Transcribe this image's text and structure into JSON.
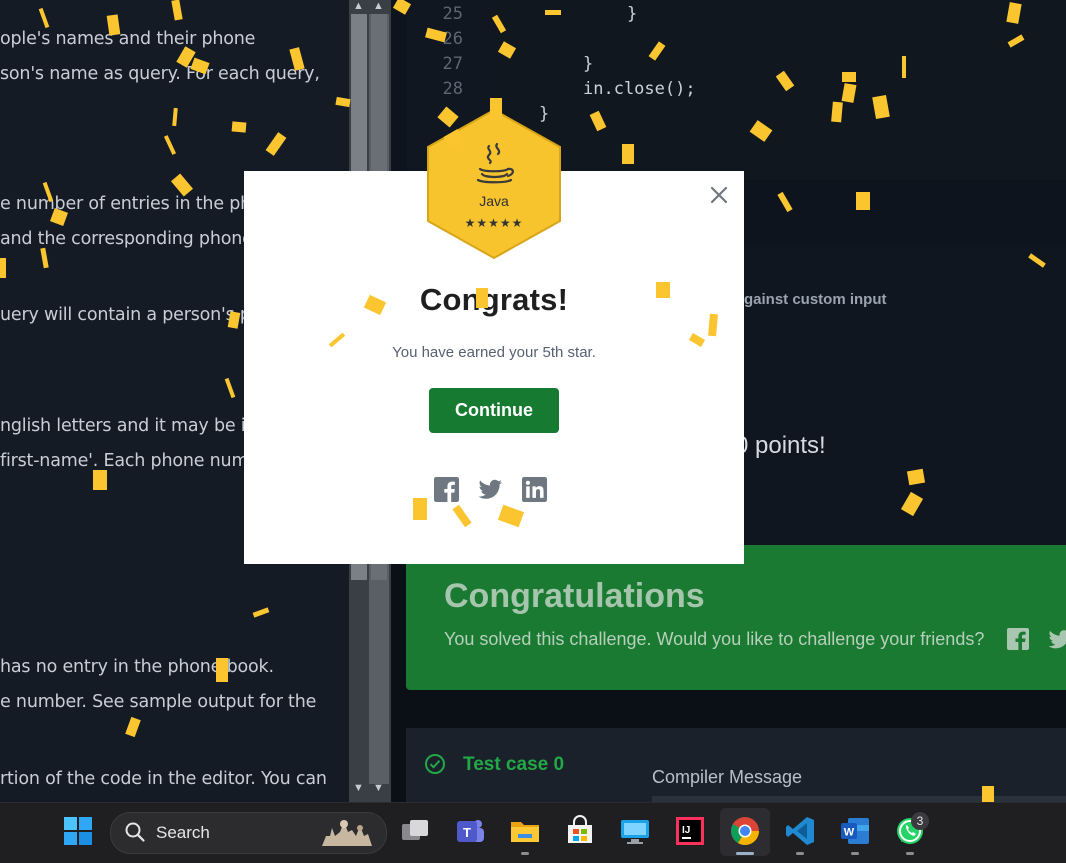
{
  "problem_text": [
    "ople's names and their phone",
    "son's name as query. For each query,",
    "e number of entries in the pho",
    "and the corresponding phone",
    "uery will contain a person's pa",
    "nglish letters and it may be in t",
    "first-name'. Each phone numb",
    "has no entry in the phone book.",
    "e number. See sample output for the",
    "rtion of the code in the editor. You can"
  ],
  "editor": {
    "line_numbers": [
      "25",
      "26",
      "27",
      "28"
    ],
    "code_lines": [
      "}",
      "",
      "}",
      "in.close();",
      "}"
    ]
  },
  "run_panel": {
    "custom_input_label": "gainst custom input",
    "points_text": "0 points!"
  },
  "banner": {
    "title": "Congratulations",
    "subtitle": "You solved this challenge. Would you like to challenge your friends?"
  },
  "test": {
    "case_label": "Test case 0",
    "compiler_label": "Compiler Message"
  },
  "modal": {
    "badge_language": "Java",
    "title": "Congrats!",
    "message": "You have earned your 5th star.",
    "continue_label": "Continue"
  },
  "taskbar": {
    "search_label": "Search",
    "whatsapp_badge": "3"
  },
  "colors": {
    "continue_green": "#167a30",
    "badge_gold": "#f7c42d",
    "confetti": "#fbc52f",
    "banner_green": "#1a7a32"
  }
}
